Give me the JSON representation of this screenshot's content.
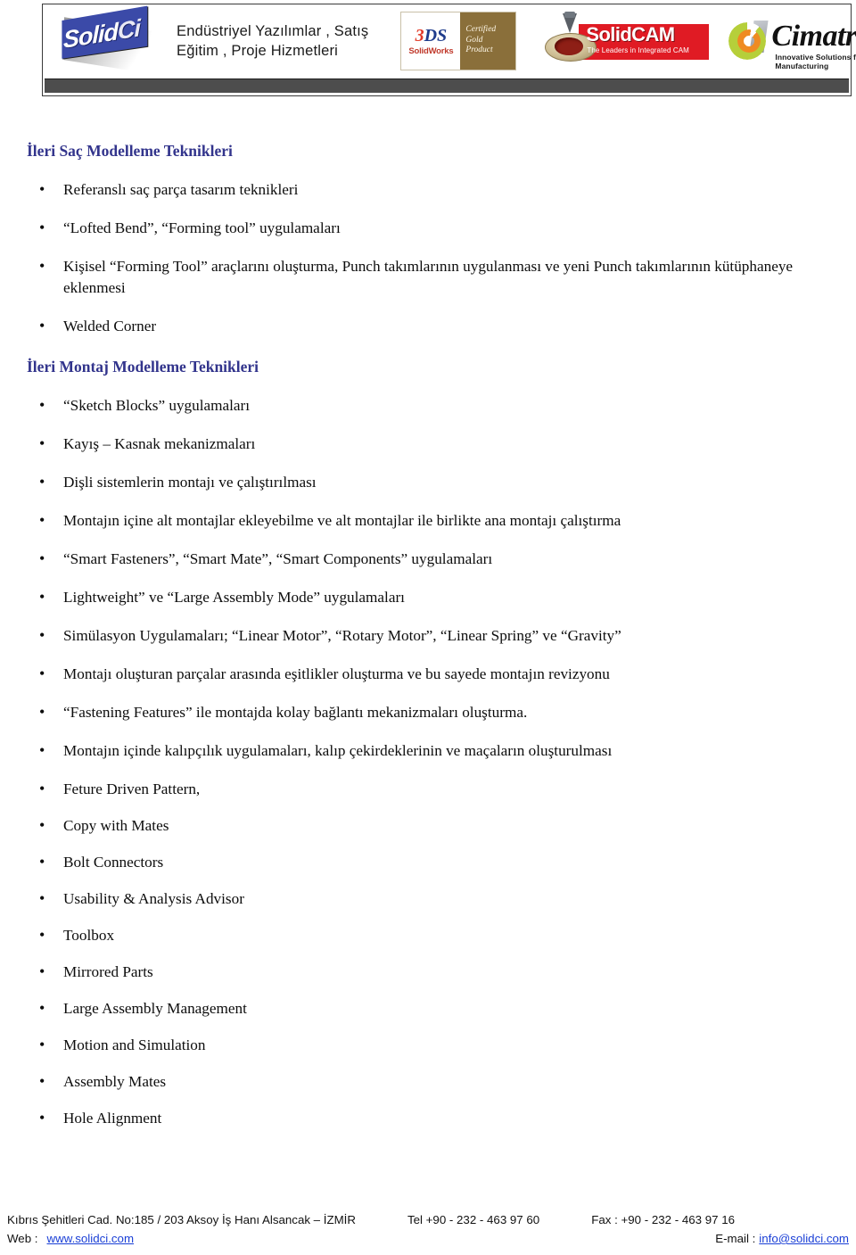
{
  "header": {
    "logo_solidci": {
      "text_main": "Solid",
      "text_accent": "Ci"
    },
    "tagline": "Endüstriyel Yazılımlar , Satış\nEğitim , Proje Hizmetleri",
    "solidworks_badge": {
      "mark": "3DS",
      "name": "SolidWorks",
      "certification": "Certified\nGold\nProduct"
    },
    "solidcam_logo": {
      "title": "SolidCAM",
      "subtitle": "The Leaders in Integrated CAM"
    },
    "cimatron_logo": {
      "name": "Cimatron",
      "tagline": "Innovative Solutions for Manufacturing"
    }
  },
  "colors": {
    "heading": "#32348c",
    "link": "#1a3fd6",
    "solidcam_red": "#e01b24",
    "solidworks_gold": "#8a6f3a",
    "header_bar_gray": "#4d4d4d",
    "solidci_blue": "#3b4aa8"
  },
  "sections": [
    {
      "heading": "İleri Saç Modelleme Teknikleri",
      "items": [
        "Referanslı saç parça tasarım teknikleri",
        "“Lofted Bend”, “Forming tool” uygulamaları",
        "Kişisel “Forming Tool” araçlarını oluşturma, Punch takımlarının uygulanması ve yeni Punch takımlarının kütüphaneye eklenmesi",
        "Welded Corner"
      ]
    },
    {
      "heading": "İleri Montaj Modelleme Teknikleri",
      "items": [
        "“Sketch Blocks” uygulamaları",
        "Kayış – Kasnak mekanizmaları",
        "Dişli sistemlerin montajı ve çalıştırılması",
        "Montajın içine alt montajlar ekleyebilme ve alt montajlar ile birlikte ana montajı çalıştırma",
        "“Smart Fasteners”, “Smart Mate”, “Smart Components” uygulamaları",
        "Lightweight” ve “Large Assembly Mode” uygulamaları",
        "Simülasyon Uygulamaları; “Linear Motor”, “Rotary Motor”, “Linear Spring” ve “Gravity”",
        "Montajı oluşturan parçalar arasında eşitlikler oluşturma ve bu sayede montajın revizyonu",
        "“Fastening Features” ile montajda kolay bağlantı mekanizmaları oluşturma.",
        "Montajın içinde kalıpçılık uygulamaları, kalıp çekirdeklerinin ve maçaların oluşturulması",
        "Feture Driven Pattern,",
        "Copy with Mates",
        "Bolt Connectors",
        "Usability & Analysis Advisor",
        "Toolbox",
        "Mirrored Parts",
        "Large Assembly Management",
        "Motion and Simulation",
        "Assembly Mates",
        "Hole Alignment"
      ]
    }
  ],
  "footer": {
    "address": "Kıbrıs Şehitleri Cad. No:185 / 203  Aksoy  İş Hanı    Alsancak – İZMİR",
    "tel": "Tel +90 - 232 - 463 97 60",
    "fax": "Fax  : +90 - 232 - 463 97 16",
    "web_label": "Web  :",
    "web_url": "www.solidci.com",
    "email_label": "E-mail :",
    "email": "info@solidci.com"
  }
}
